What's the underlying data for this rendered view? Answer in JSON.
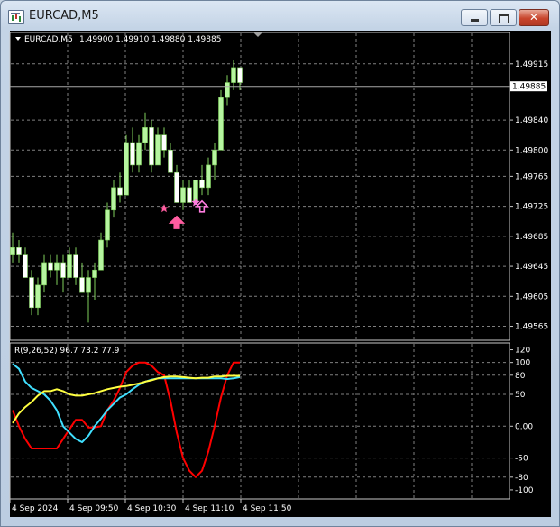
{
  "window": {
    "title": "EURCAD,M5",
    "minimize_icon": "minimize-icon",
    "maximize_icon": "maximize-icon",
    "close_icon": "close-icon",
    "close_glyph": "✕"
  },
  "colors": {
    "background": "#000000",
    "grid": "#808080",
    "bull_candle": "#b6f5a0",
    "bear_candle": "#ffffff",
    "wick": "#7fd05c",
    "signal_arrow": "#ff5ca0",
    "signal_arrow_2": "#ff7de0",
    "rsi_red": "#ff0000",
    "rsi_cyan": "#40e0ff",
    "rsi_yellow": "#ffff40"
  },
  "chart_data": [
    {
      "type": "candlestick",
      "title": "EURCAD,M5",
      "ohlc_header": "1.49900 1.49910 1.49880 1.49885",
      "current_price_label": "1.49885",
      "current_price": 1.49885,
      "ylim": [
        1.4955,
        1.4994
      ],
      "grid": true,
      "y_ticks": [
        "1.49915",
        "1.49840",
        "1.49800",
        "1.49765",
        "1.49725",
        "1.49685",
        "1.49645",
        "1.49605",
        "1.49565"
      ],
      "y_tick_values": [
        1.49915,
        1.4984,
        1.498,
        1.49765,
        1.49725,
        1.49685,
        1.49645,
        1.49605,
        1.49565
      ],
      "candles": [
        {
          "o": 1.4966,
          "h": 1.4969,
          "l": 1.4965,
          "c": 1.4967
        },
        {
          "o": 1.4967,
          "h": 1.4968,
          "l": 1.4965,
          "c": 1.4966
        },
        {
          "o": 1.4966,
          "h": 1.4967,
          "l": 1.4963,
          "c": 1.4963
        },
        {
          "o": 1.4963,
          "h": 1.4964,
          "l": 1.4958,
          "c": 1.4959
        },
        {
          "o": 1.4959,
          "h": 1.4963,
          "l": 1.4958,
          "c": 1.4962
        },
        {
          "o": 1.4962,
          "h": 1.4966,
          "l": 1.4961,
          "c": 1.4965
        },
        {
          "o": 1.4965,
          "h": 1.4966,
          "l": 1.4963,
          "c": 1.4964
        },
        {
          "o": 1.4964,
          "h": 1.4966,
          "l": 1.4962,
          "c": 1.4965
        },
        {
          "o": 1.4965,
          "h": 1.4966,
          "l": 1.4961,
          "c": 1.4963
        },
        {
          "o": 1.4963,
          "h": 1.4967,
          "l": 1.4963,
          "c": 1.4966
        },
        {
          "o": 1.4966,
          "h": 1.4967,
          "l": 1.4962,
          "c": 1.4963
        },
        {
          "o": 1.4963,
          "h": 1.4965,
          "l": 1.4961,
          "c": 1.4961
        },
        {
          "o": 1.4961,
          "h": 1.4964,
          "l": 1.4957,
          "c": 1.4963
        },
        {
          "o": 1.4963,
          "h": 1.4965,
          "l": 1.496,
          "c": 1.4964
        },
        {
          "o": 1.4964,
          "h": 1.4969,
          "l": 1.4964,
          "c": 1.4968
        },
        {
          "o": 1.4968,
          "h": 1.4973,
          "l": 1.4967,
          "c": 1.4972
        },
        {
          "o": 1.4972,
          "h": 1.4976,
          "l": 1.4971,
          "c": 1.4975
        },
        {
          "o": 1.4975,
          "h": 1.4977,
          "l": 1.4973,
          "c": 1.4974
        },
        {
          "o": 1.4974,
          "h": 1.4982,
          "l": 1.4974,
          "c": 1.4981
        },
        {
          "o": 1.4981,
          "h": 1.4983,
          "l": 1.4977,
          "c": 1.4978
        },
        {
          "o": 1.4978,
          "h": 1.4982,
          "l": 1.4977,
          "c": 1.4981
        },
        {
          "o": 1.4981,
          "h": 1.4985,
          "l": 1.498,
          "c": 1.4983
        },
        {
          "o": 1.4983,
          "h": 1.4984,
          "l": 1.4977,
          "c": 1.4978
        },
        {
          "o": 1.4978,
          "h": 1.4983,
          "l": 1.4978,
          "c": 1.4982
        },
        {
          "o": 1.4982,
          "h": 1.4983,
          "l": 1.4979,
          "c": 1.498
        },
        {
          "o": 1.498,
          "h": 1.4981,
          "l": 1.4977,
          "c": 1.4977
        },
        {
          "o": 1.4977,
          "h": 1.4978,
          "l": 1.4973,
          "c": 1.4973
        },
        {
          "o": 1.4973,
          "h": 1.4976,
          "l": 1.4972,
          "c": 1.4975
        },
        {
          "o": 1.4975,
          "h": 1.4976,
          "l": 1.4973,
          "c": 1.4973
        },
        {
          "o": 1.4973,
          "h": 1.4976,
          "l": 1.4973,
          "c": 1.4976
        },
        {
          "o": 1.4976,
          "h": 1.4978,
          "l": 1.4974,
          "c": 1.4975
        },
        {
          "o": 1.4975,
          "h": 1.4979,
          "l": 1.4974,
          "c": 1.4978
        },
        {
          "o": 1.4978,
          "h": 1.4981,
          "l": 1.4976,
          "c": 1.498
        },
        {
          "o": 1.498,
          "h": 1.4988,
          "l": 1.498,
          "c": 1.4987
        },
        {
          "o": 1.4987,
          "h": 1.499,
          "l": 1.4986,
          "c": 1.4989
        },
        {
          "o": 1.4989,
          "h": 1.4992,
          "l": 1.4988,
          "c": 1.4991
        },
        {
          "o": 1.4991,
          "h": 1.4991,
          "l": 1.4988,
          "c": 1.4989
        }
      ],
      "signals": [
        {
          "candle": 26,
          "price": 1.49712,
          "type": "arrow-up",
          "color": "#ff5ca0"
        },
        {
          "candle": 24,
          "price": 1.49722,
          "type": "star",
          "color": "#ff5ca0"
        },
        {
          "candle": 30,
          "price": 1.49732,
          "type": "arrow-up",
          "color": "#ff7de0"
        },
        {
          "candle": 29,
          "price": 1.4973,
          "type": "star",
          "color": "#ff7de0"
        }
      ]
    },
    {
      "type": "line",
      "title": "R(9,26,52) 96.7 73.2 77.9",
      "ylim": [
        -110,
        125
      ],
      "grid": true,
      "y_ticks": [
        "120",
        "100",
        "80",
        "50",
        "0.00",
        "-50",
        "-80",
        "-100"
      ],
      "y_tick_values": [
        120,
        100,
        80,
        50,
        0,
        -50,
        -80,
        -100
      ],
      "series": [
        {
          "color": "#ff0000",
          "values": [
            25,
            0,
            -20,
            -35,
            -35,
            -35,
            -35,
            -35,
            -20,
            -5,
            10,
            10,
            -2,
            -2,
            0,
            25,
            40,
            60,
            85,
            95,
            100,
            100,
            95,
            85,
            80,
            40,
            -10,
            -50,
            -70,
            -80,
            -70,
            -40,
            0,
            45,
            80,
            100,
            100
          ]
        },
        {
          "color": "#40e0ff",
          "values": [
            98,
            90,
            70,
            60,
            55,
            50,
            40,
            25,
            0,
            -10,
            -20,
            -25,
            -15,
            0,
            12,
            25,
            35,
            45,
            50,
            58,
            65,
            70,
            73,
            75,
            75,
            75,
            75,
            75,
            75,
            75,
            75,
            75,
            75,
            75,
            74,
            75,
            77
          ]
        },
        {
          "color": "#ffff40",
          "values": [
            5,
            20,
            30,
            38,
            48,
            55,
            55,
            58,
            55,
            50,
            48,
            48,
            50,
            52,
            55,
            58,
            60,
            62,
            63,
            65,
            67,
            70,
            72,
            75,
            77,
            78,
            78,
            77,
            76,
            75,
            76,
            76,
            78,
            78,
            79,
            79,
            79
          ]
        }
      ]
    }
  ],
  "x_axis": {
    "labels": [
      "4 Sep 2024",
      "4 Sep 09:50",
      "4 Sep 10:30",
      "4 Sep 11:10",
      "4 Sep 11:50"
    ]
  }
}
